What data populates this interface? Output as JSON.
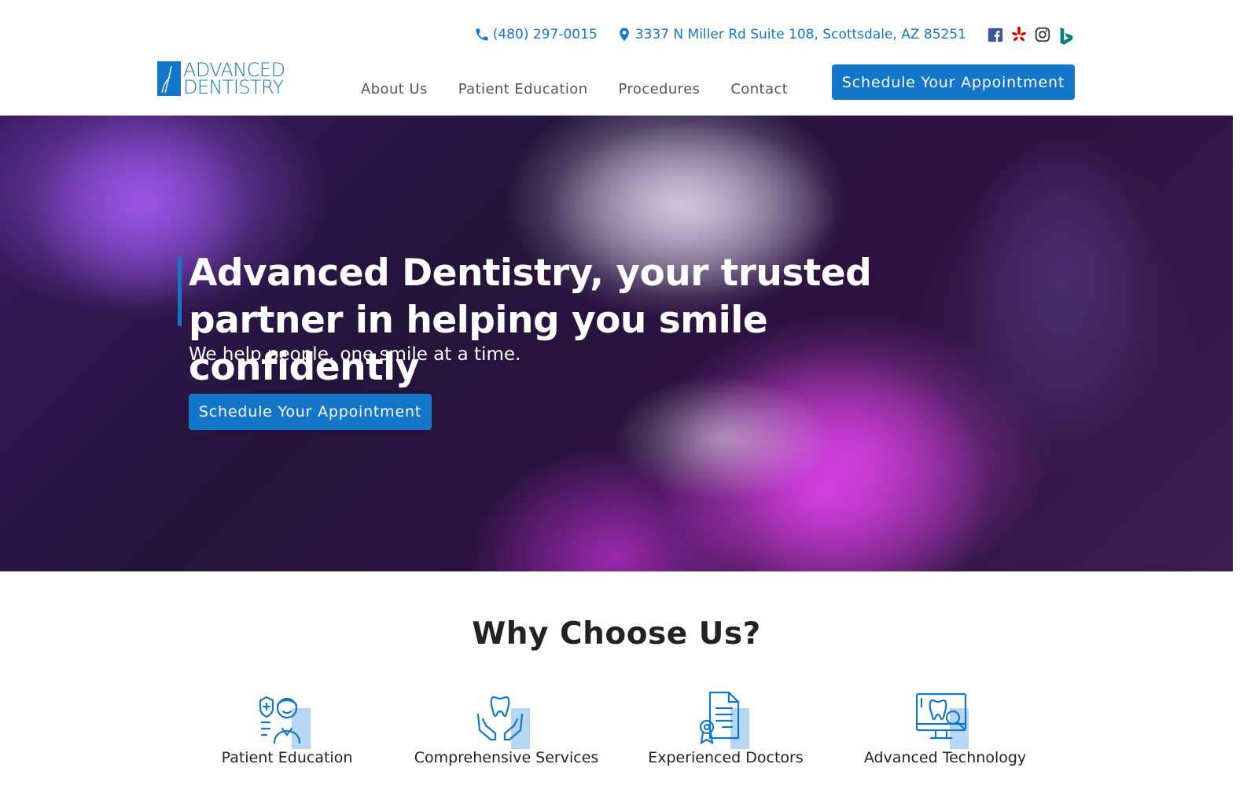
{
  "topbar": {
    "phone": "(480) 297-0015",
    "address": "3337 N Miller Rd Suite 108, Scottsdale, AZ 85251",
    "social_icons": [
      "facebook-icon",
      "yelp-icon",
      "instagram-icon",
      "bing-icon"
    ]
  },
  "logo": {
    "line1": "ADVANCED",
    "line2": "DENTISTRY"
  },
  "nav": {
    "items": [
      {
        "label": "About Us"
      },
      {
        "label": "Patient Education"
      },
      {
        "label": "Procedures"
      },
      {
        "label": "Contact"
      }
    ],
    "cta": "Schedule Your Appointment"
  },
  "hero": {
    "title": "Advanced Dentistry, your trusted partner in helping you smile confidently",
    "subtitle": "We help people, one smile at a time.",
    "cta": "Schedule Your Appointment"
  },
  "why": {
    "title": "Why Choose Us?",
    "features": [
      {
        "label": "Patient Education",
        "icon": "doctor-shield-icon"
      },
      {
        "label": "Comprehensive Services",
        "icon": "tooth-hands-icon"
      },
      {
        "label": "Experienced Doctors",
        "icon": "certificate-icon"
      },
      {
        "label": "Advanced Technology",
        "icon": "monitor-tooth-icon"
      }
    ]
  },
  "colors": {
    "brand": "#1476c8",
    "brand_light": "#b6d6f2",
    "text": "#222222",
    "nav": "#555555"
  }
}
